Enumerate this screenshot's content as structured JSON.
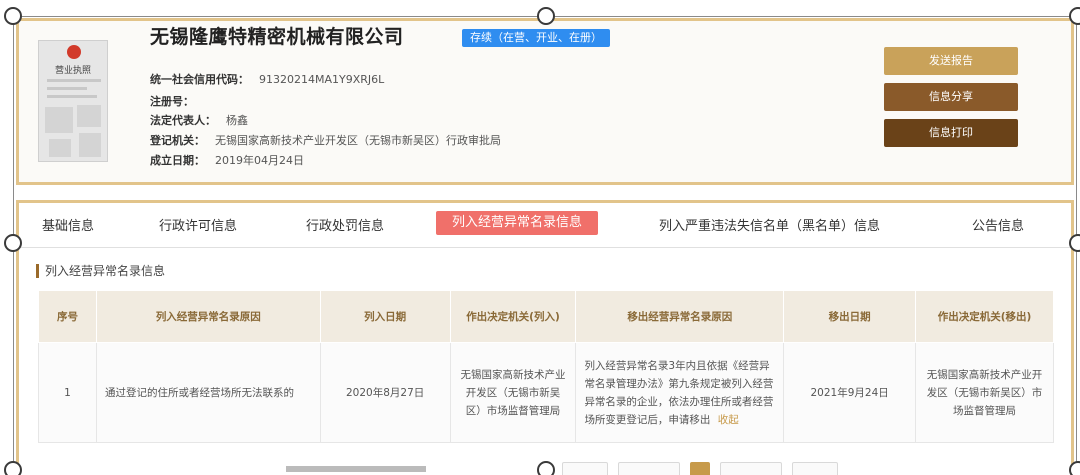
{
  "company": {
    "name": "无锡隆鹰特精密机械有限公司",
    "status": "存续（在营、开业、在册）",
    "fields": [
      {
        "label": "统一社会信用代码：",
        "value": "91320214MA1Y9XRJ6L"
      },
      {
        "label": "注册号：",
        "value": ""
      },
      {
        "label": "法定代表人：",
        "value": "杨鑫"
      },
      {
        "label": "登记机关：",
        "value": "无锡国家高新技术产业开发区（无锡市新吴区）行政审批局"
      },
      {
        "label": "成立日期：",
        "value": "2019年04月24日"
      }
    ]
  },
  "license": {
    "title": "营业执照"
  },
  "actions": {
    "report": "发送报告",
    "share": "信息分享",
    "print": "信息打印"
  },
  "tabs": [
    "基础信息",
    "行政许可信息",
    "行政处罚信息",
    "列入经营异常名录信息",
    "列入严重违法失信名单（黑名单）信息",
    "公告信息"
  ],
  "section": {
    "title": "列入经营异常名录信息"
  },
  "table": {
    "headers": [
      "序号",
      "列入经营异常名录原因",
      "列入日期",
      "作出决定机关(列入)",
      "移出经营异常名录原因",
      "移出日期",
      "作出决定机关(移出)"
    ],
    "rows": [
      {
        "no": "1",
        "reason": "通过登记的住所或者经营场所无法联系的",
        "date_in": "2020年8月27日",
        "org_in": "无锡国家高新技术产业开发区（无锡市新吴区）市场监督管理局",
        "remove_reason": "列入经营异常名录3年内且依据《经营异常名录管理办法》第九条规定被列入经营异常名录的企业，依法办理住所或者经营场所变更登记后，申请移出",
        "remove_link": "收起",
        "date_out": "2021年9月24日",
        "org_out": "无锡国家高新技术产业开发区（无锡市新吴区）市场监督管理局"
      }
    ]
  },
  "colors": {
    "accent_gold": "#e2c48a",
    "status_blue": "#2f8df0",
    "active_tab": "#f0706a",
    "btn_report": "#c9a25a",
    "btn_share": "#8a5a2a",
    "btn_print": "#6a4218"
  }
}
